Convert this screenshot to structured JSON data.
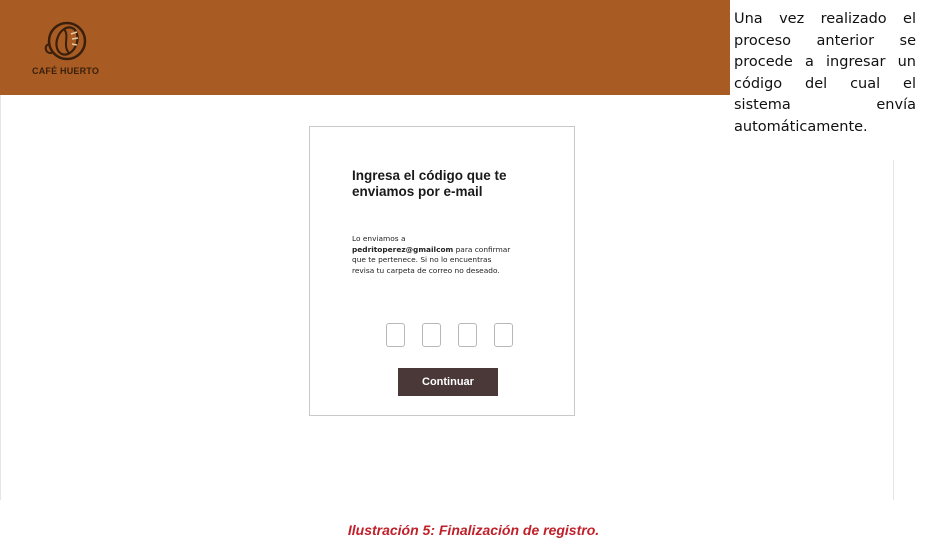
{
  "header": {
    "brand_name": "CAFÉ HUERTO",
    "background_color": "#a85c24"
  },
  "side_note": {
    "text": "Una vez realizado el proceso anterior se procede a ingresar un código del cual el sistema envía automáticamente."
  },
  "verification_card": {
    "title": "Ingresa el código que te enviamos por e-mail",
    "body_intro": "Lo enviamos a",
    "email": "pedritoperez@gmailcom",
    "body_rest": "para confirmar que te pertenece. Si no lo encuentras revisa tu carpeta de correo no deseado.",
    "code_digits": [
      "",
      "",
      "",
      ""
    ],
    "continue_label": "Continuar",
    "button_color": "#4a3838"
  },
  "caption": {
    "text": "Ilustración 5: Finalización de registro.",
    "color": "#c0202a"
  }
}
